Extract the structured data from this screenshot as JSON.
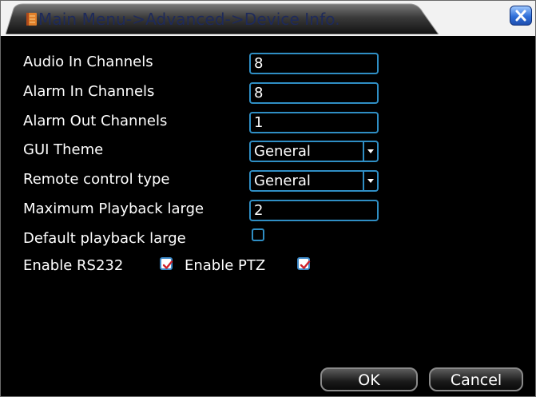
{
  "window": {
    "title": "Main Menu->Advanced->Device Info."
  },
  "form": {
    "audio_in": {
      "label": "Audio In Channels",
      "value": "8"
    },
    "alarm_in": {
      "label": "Alarm In Channels",
      "value": "8"
    },
    "alarm_out": {
      "label": "Alarm Out Channels",
      "value": "1"
    },
    "gui_theme": {
      "label": "GUI Theme",
      "value": "General"
    },
    "remote_control": {
      "label": "Remote control type",
      "value": "General"
    },
    "max_playback": {
      "label": "Maximum Playback large",
      "value": "2"
    },
    "default_playback": {
      "label": "Default playback large",
      "checked": false
    },
    "rs232": {
      "label": "Enable RS232",
      "checked": true
    },
    "ptz": {
      "label": "Enable PTZ",
      "checked": true
    }
  },
  "buttons": {
    "ok": "OK",
    "cancel": "Cancel"
  },
  "colors": {
    "background": "#000000",
    "field_border": "#2f8ec4",
    "title_text": "#1e2a5a",
    "close_button": "#2f6fd8"
  },
  "icons": {
    "title": "menu-icon",
    "close": "close-icon",
    "dropdown": "dropdown-arrow-icon",
    "check": "checkmark-icon"
  }
}
